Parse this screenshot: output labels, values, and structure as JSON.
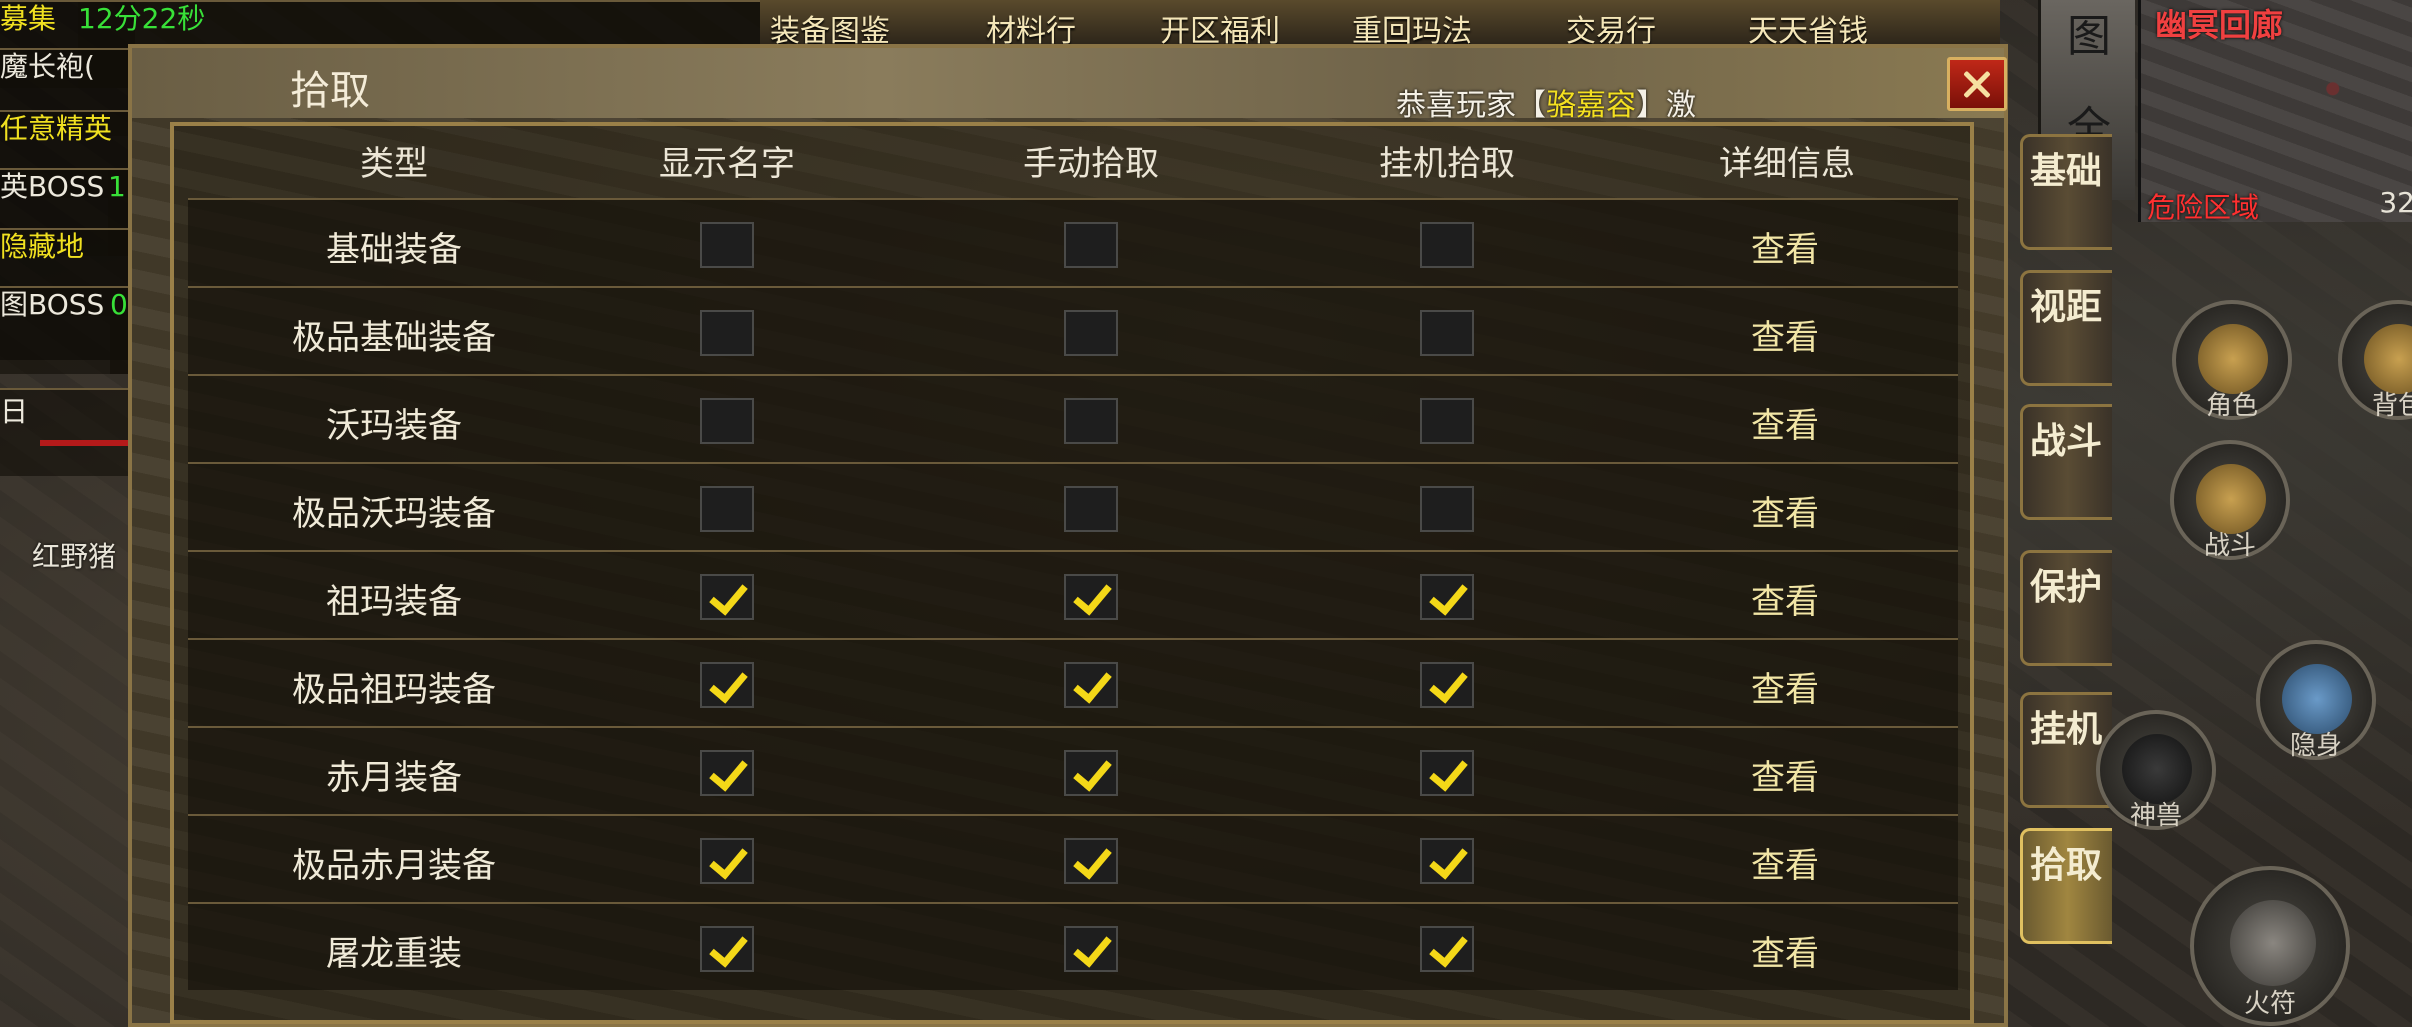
{
  "hud": {
    "tracker_lines": [
      {
        "text": "募集",
        "color": "yellow"
      },
      {
        "text": "12分22秒",
        "color": "green"
      },
      {
        "text": "魔长袍(",
        "color": "white"
      },
      {
        "text": "任意精英",
        "color": "yellow"
      },
      {
        "text": "英BOSS",
        "color": "white"
      },
      {
        "text": "1",
        "color": "green"
      },
      {
        "text": "隐藏地",
        "color": "yellow"
      },
      {
        "text": "图BOSS",
        "color": "white"
      },
      {
        "text": "0",
        "color": "green"
      },
      {
        "text": "日",
        "color": "white"
      }
    ],
    "world_label": "红野猪",
    "top_menu": [
      "装备图鉴",
      "材料行",
      "开区福利",
      "重回玛法",
      "交易行",
      "天天省钱"
    ],
    "map_button_glyphs": [
      "图",
      "全"
    ],
    "minimap": {
      "title": "幽冥回廊",
      "zone": "危险区域",
      "coord": "32"
    },
    "side_tabs": [
      "基础",
      "视距",
      "战斗",
      "保护",
      "挂机",
      "拾取"
    ],
    "active_tab": "拾取",
    "round_buttons": [
      {
        "name": "角色"
      },
      {
        "name": "背包",
        "label": "背包"
      },
      {
        "name": "战斗"
      },
      {
        "name": "隐身"
      },
      {
        "name": "神兽"
      },
      {
        "name": "火符"
      }
    ]
  },
  "dialog": {
    "title": "拾取",
    "columns": [
      "类型",
      "显示名字",
      "手动拾取",
      "挂机拾取",
      "详细信息"
    ],
    "broadcast": {
      "prefix": "恭喜玩家",
      "bracket_open": "【",
      "name": "骆嘉容",
      "bracket_close": "】",
      "suffix": "激"
    },
    "view_label": "查看",
    "rows": [
      {
        "type": "基础装备",
        "show_name": false,
        "manual": false,
        "auto": false
      },
      {
        "type": "极品基础装备",
        "show_name": false,
        "manual": false,
        "auto": false
      },
      {
        "type": "沃玛装备",
        "show_name": false,
        "manual": false,
        "auto": false
      },
      {
        "type": "极品沃玛装备",
        "show_name": false,
        "manual": false,
        "auto": false
      },
      {
        "type": "祖玛装备",
        "show_name": true,
        "manual": true,
        "auto": true
      },
      {
        "type": "极品祖玛装备",
        "show_name": true,
        "manual": true,
        "auto": true
      },
      {
        "type": "赤月装备",
        "show_name": true,
        "manual": true,
        "auto": true
      },
      {
        "type": "极品赤月装备",
        "show_name": true,
        "manual": true,
        "auto": true
      },
      {
        "type": "屠龙重装",
        "show_name": true,
        "manual": true,
        "auto": true
      }
    ]
  },
  "colors": {
    "checkmark": "#f4d818",
    "accent_border": "#9a8048",
    "close_button": "#c02818",
    "view_link": "#f2e6a6",
    "minimap_title": "#f04040"
  }
}
